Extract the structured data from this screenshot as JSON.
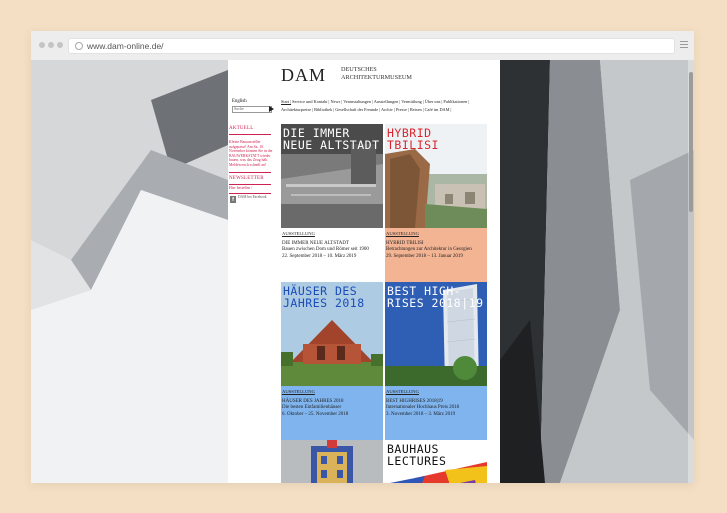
{
  "browser": {
    "url": "www.dam-online.de/"
  },
  "site": {
    "logo_mark": "DAM",
    "logo_line1": "DEUTSCHES",
    "logo_line2": "ARCHITEKTURMUSEUM",
    "lang": "English",
    "search_placeholder": "Suche",
    "nav": [
      "Start |",
      "Service und Kontakt |",
      "News |",
      "Veranstaltungen |",
      "Ausstellungen |",
      "Vermittlung |",
      "Über uns |",
      "Publikationen |",
      "Architekturpreise |",
      "Bibliothek |",
      "Gesellschaft der Freunde |",
      "Archiv |",
      "Presse |",
      "Reisen |",
      "Café im DAM |"
    ],
    "sidebar": {
      "aktuell_label": "AKTUELL",
      "aktuell_text": "Kleine Bauaussteller aufgepasst! Am Sa. 10. November können Sie in der BAUWERKSTATT wieder bauen, was das Zeug hält. Melden euch schnell an!",
      "newsletter_label": "NEWSLETTER",
      "newsletter_text": "Hier bestellen /",
      "facebook_text": "DAM bei Facebook"
    },
    "tiles": [
      {
        "title": "DIE IMMER NEUE ALTSTADT",
        "category": "AUSSTELLUNG",
        "lines": [
          "DIE IMMER NEUE ALTSTADT",
          "Bauen zwischen Dom und Römer seit 1900",
          "22. September 2018 – 10. März 2019"
        ],
        "caption_color": "#f3b493"
      },
      {
        "title": "HYBRID TBILISI",
        "category": "AUSSTELLUNG",
        "lines": [
          "HYBRID TBILISI",
          "Betrachtungen zur Architektur in Georgien",
          "29. September 2018 – 13. Januar 2019"
        ],
        "caption_color": "#f3b493"
      },
      {
        "title": "HÄUSER DES JAHRES 2018",
        "category": "AUSSTELLUNG",
        "lines": [
          "HÄUSER DES JAHRES 2018",
          "Die besten Einfamilienhäuser",
          "6. Oktober – 25. November 2018"
        ],
        "caption_color": "#7fb4ee"
      },
      {
        "title": "BEST HIGH-RISES 2018|19",
        "category": "AUSSTELLUNG",
        "lines": [
          "BEST HIGHRISES 2018|19",
          "Internationaler Hochhaus Preis 2018",
          "3. November 2018 – 3. März 2019"
        ],
        "caption_color": "#7fb4ee"
      },
      {
        "title": "",
        "category": "",
        "lines": []
      },
      {
        "title": "BAUHAUS LECTURES",
        "category": "",
        "lines": []
      }
    ],
    "colors": {
      "accent": "#d02150",
      "peach": "#f3b493",
      "blue": "#7fb4ee",
      "title_blue": "#1a4db8"
    }
  }
}
